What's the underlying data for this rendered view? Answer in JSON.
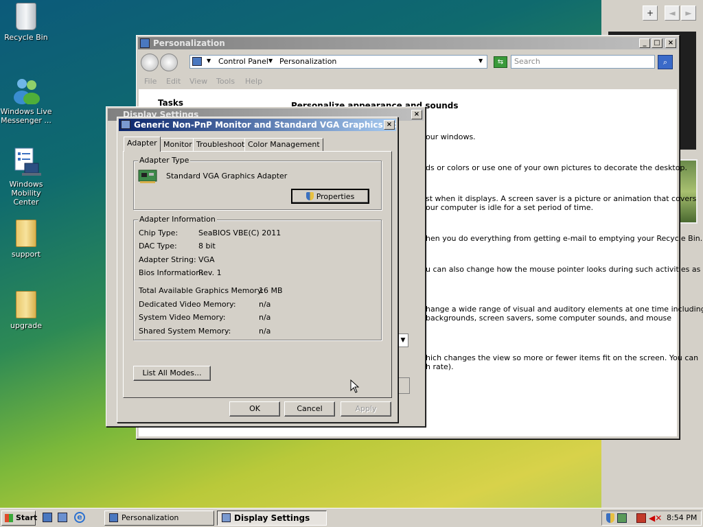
{
  "desktop": {
    "icons": [
      {
        "label": "Recycle Bin"
      },
      {
        "label": "Windows Live Messenger ..."
      },
      {
        "label": "Windows Mobility Center"
      },
      {
        "label": "support"
      },
      {
        "label": "upgrade"
      }
    ]
  },
  "sidebar": {
    "add_label": "+",
    "prev_label": "◄",
    "next_label": "►"
  },
  "personalization": {
    "title": "Personalization",
    "breadcrumb": [
      "Control Panel",
      "Personalization"
    ],
    "search_placeholder": "Search",
    "menu": [
      "File",
      "Edit",
      "View",
      "Tools",
      "Help"
    ],
    "tasks_heading": "Tasks",
    "heading": "Personalize appearance and sounds",
    "lines": [
      "our windows.",
      "ds or colors or use one of your own pictures to decorate the desktop.",
      "st when it displays. A screen saver is a picture or animation that covers",
      "our computer is idle for a set period of time.",
      "hen you do everything from getting e-mail to emptying your Recycle Bin.",
      "u can also change how the mouse pointer looks during such activities as",
      "hange a wide range of visual and auditory elements at one time including",
      "backgrounds, screen savers, some computer sounds, and mouse",
      "hich changes the view so more or fewer items fit on the screen. You can",
      "h rate)."
    ]
  },
  "display_settings": {
    "title": "Display Settings"
  },
  "adapter_dialog": {
    "title": "Generic Non-PnP Monitor and Standard VGA Graphics Adapte...",
    "tabs": [
      "Adapter",
      "Monitor",
      "Troubleshoot",
      "Color Management"
    ],
    "adapter_type_title": "Adapter Type",
    "adapter_name": "Standard VGA Graphics Adapter",
    "properties_label": "Properties",
    "adapter_info_title": "Adapter Information",
    "info_rows": [
      {
        "label": "Chip Type:",
        "value": "SeaBIOS VBE(C) 2011"
      },
      {
        "label": "DAC Type:",
        "value": "8 bit"
      },
      {
        "label": "Adapter String:",
        "value": "VGA"
      },
      {
        "label": "Bios Information:",
        "value": "Rev. 1"
      }
    ],
    "memory_rows": [
      {
        "label": "Total Available Graphics Memory:",
        "value": "16 MB"
      },
      {
        "label": "Dedicated Video Memory:",
        "value": "n/a"
      },
      {
        "label": "System Video Memory:",
        "value": "n/a"
      },
      {
        "label": "Shared System Memory:",
        "value": "n/a"
      }
    ],
    "list_modes_label": "List All Modes...",
    "ok_label": "OK",
    "cancel_label": "Cancel",
    "apply_label": "Apply"
  },
  "taskbar": {
    "start_label": "Start",
    "tasks": [
      "Personalization",
      "Display Settings"
    ],
    "clock": "8:54 PM"
  }
}
